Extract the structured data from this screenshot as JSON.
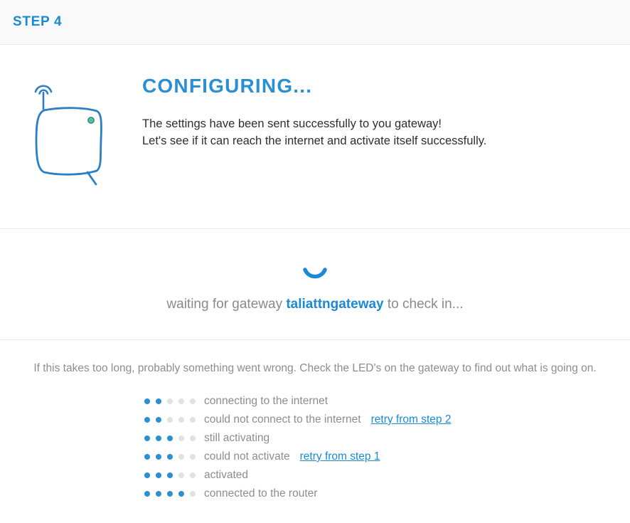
{
  "header": {
    "step_label": "STEP 4"
  },
  "intro": {
    "icon_name": "gateway-router-icon",
    "led_color": "#5dc77a",
    "outline_color": "#2b7fc4",
    "title": "CONFIGURING...",
    "lines": [
      "The settings have been sent successfully to you gateway!",
      "Let's see if it can reach the internet and activate itself successfully."
    ]
  },
  "waiting": {
    "spinner_name": "loading-spinner-icon",
    "spinner_color": "#1a8ad4",
    "prefix": "waiting for gateway ",
    "gateway_name": "taliattngateway",
    "suffix": " to check in..."
  },
  "help": {
    "text": "If this takes too long, probably something went wrong. Check the LED's on the gateway to find out what is going on.",
    "total_dots": 5,
    "rows": [
      {
        "filled": 2,
        "label": "connecting to the internet",
        "link": ""
      },
      {
        "filled": 2,
        "label": "could not connect to the internet",
        "link": "retry from step 2"
      },
      {
        "filled": 3,
        "label": "still activating",
        "link": ""
      },
      {
        "filled": 3,
        "label": "could not activate",
        "link": "retry from step 1"
      },
      {
        "filled": 3,
        "label": "activated",
        "link": ""
      },
      {
        "filled": 4,
        "label": "connected to the router",
        "link": ""
      }
    ]
  },
  "colors": {
    "brand_blue": "#1a8ad4",
    "dot_on": "#2b8fd4",
    "dot_off": "#e2e2e2",
    "muted_text": "#8d8d8d"
  }
}
